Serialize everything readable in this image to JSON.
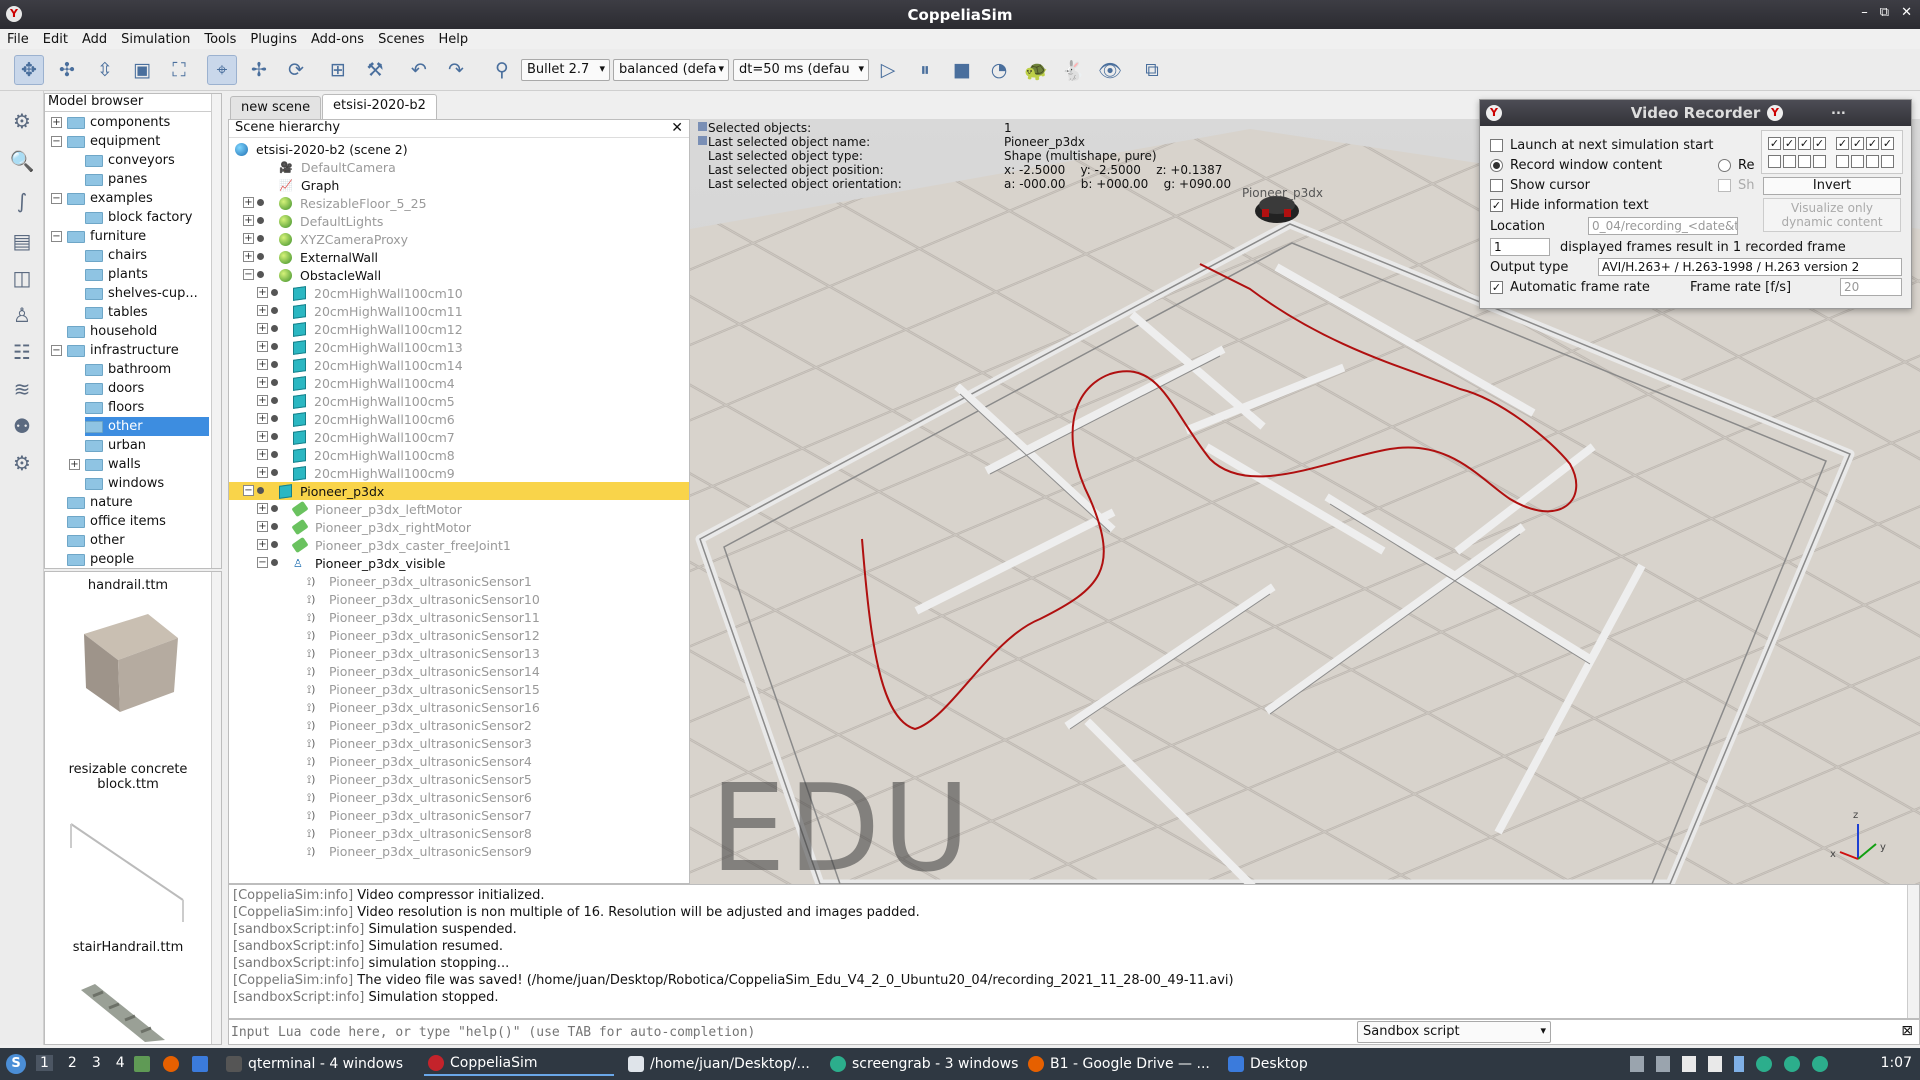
{
  "window": {
    "title": "CoppeliaSim"
  },
  "menu": [
    "File",
    "Edit",
    "Add",
    "Simulation",
    "Tools",
    "Plugins",
    "Add-ons",
    "Scenes",
    "Help"
  ],
  "toolbar": {
    "engine": "Bullet 2.7",
    "accuracy": "balanced (defa",
    "dt": "dt=50 ms (defau"
  },
  "model_browser": {
    "title": "Model browser",
    "items": [
      {
        "label": "components",
        "level": 0,
        "exp": "+"
      },
      {
        "label": "equipment",
        "level": 0,
        "exp": "-"
      },
      {
        "label": "conveyors",
        "level": 1
      },
      {
        "label": "panes",
        "level": 1
      },
      {
        "label": "examples",
        "level": 0,
        "exp": "-"
      },
      {
        "label": "block factory",
        "level": 1
      },
      {
        "label": "furniture",
        "level": 0,
        "exp": "-"
      },
      {
        "label": "chairs",
        "level": 1
      },
      {
        "label": "plants",
        "level": 1
      },
      {
        "label": "shelves-cup...",
        "level": 1
      },
      {
        "label": "tables",
        "level": 1
      },
      {
        "label": "household",
        "level": 0
      },
      {
        "label": "infrastructure",
        "level": 0,
        "exp": "-"
      },
      {
        "label": "bathroom",
        "level": 1
      },
      {
        "label": "doors",
        "level": 1
      },
      {
        "label": "floors",
        "level": 1
      },
      {
        "label": "other",
        "level": 1,
        "selected": true
      },
      {
        "label": "urban",
        "level": 1
      },
      {
        "label": "walls",
        "level": 1,
        "exp": "+"
      },
      {
        "label": "windows",
        "level": 1
      },
      {
        "label": "nature",
        "level": 0
      },
      {
        "label": "office items",
        "level": 0
      },
      {
        "label": "other",
        "level": 0
      },
      {
        "label": "people",
        "level": 0
      }
    ],
    "thumbs": [
      {
        "label": "handrail.ttm"
      },
      {
        "label": "resizable concrete block.ttm"
      },
      {
        "label": "stairHandrail.ttm"
      }
    ]
  },
  "scene_tabs": [
    "new scene",
    "etsisi-2020-b2"
  ],
  "hierarchy": {
    "title": "Scene hierarchy",
    "rows": [
      {
        "label": "etsisi-2020-b2 (scene 2)",
        "indent": 0,
        "icon": "world"
      },
      {
        "label": "DefaultCamera",
        "indent": 1,
        "icon": "camera",
        "dim": true
      },
      {
        "label": "Graph",
        "indent": 1,
        "icon": "graph"
      },
      {
        "label": "ResizableFloor_5_25",
        "indent": 1,
        "icon": "sph",
        "dim": true,
        "exp": "+"
      },
      {
        "label": "DefaultLights",
        "indent": 1,
        "icon": "sph",
        "dim": true,
        "exp": "+"
      },
      {
        "label": "XYZCameraProxy",
        "indent": 1,
        "icon": "sph",
        "dim": true,
        "exp": "+"
      },
      {
        "label": "ExternalWall",
        "indent": 1,
        "icon": "sph",
        "exp": "+"
      },
      {
        "label": "ObstacleWall",
        "indent": 1,
        "icon": "sph",
        "exp": "-"
      },
      {
        "label": "20cmHighWall100cm10",
        "indent": 2,
        "icon": "cube",
        "dim": true,
        "exp": "+"
      },
      {
        "label": "20cmHighWall100cm11",
        "indent": 2,
        "icon": "cube",
        "dim": true,
        "exp": "+"
      },
      {
        "label": "20cmHighWall100cm12",
        "indent": 2,
        "icon": "cube",
        "dim": true,
        "exp": "+"
      },
      {
        "label": "20cmHighWall100cm13",
        "indent": 2,
        "icon": "cube",
        "dim": true,
        "exp": "+"
      },
      {
        "label": "20cmHighWall100cm14",
        "indent": 2,
        "icon": "cube",
        "dim": true,
        "exp": "+"
      },
      {
        "label": "20cmHighWall100cm4",
        "indent": 2,
        "icon": "cube",
        "dim": true,
        "exp": "+"
      },
      {
        "label": "20cmHighWall100cm5",
        "indent": 2,
        "icon": "cube",
        "dim": true,
        "exp": "+"
      },
      {
        "label": "20cmHighWall100cm6",
        "indent": 2,
        "icon": "cube",
        "dim": true,
        "exp": "+"
      },
      {
        "label": "20cmHighWall100cm7",
        "indent": 2,
        "icon": "cube",
        "dim": true,
        "exp": "+"
      },
      {
        "label": "20cmHighWall100cm8",
        "indent": 2,
        "icon": "cube",
        "dim": true,
        "exp": "+"
      },
      {
        "label": "20cmHighWall100cm9",
        "indent": 2,
        "icon": "cube",
        "dim": true,
        "exp": "+"
      },
      {
        "label": "Pioneer_p3dx",
        "indent": 1,
        "icon": "cube",
        "exp": "-",
        "selected": true
      },
      {
        "label": "Pioneer_p3dx_leftMotor",
        "indent": 2,
        "icon": "joint",
        "dim": true,
        "exp": "+"
      },
      {
        "label": "Pioneer_p3dx_rightMotor",
        "indent": 2,
        "icon": "joint",
        "dim": true,
        "exp": "+"
      },
      {
        "label": "Pioneer_p3dx_caster_freeJoint1",
        "indent": 2,
        "icon": "joint",
        "dim": true,
        "exp": "+"
      },
      {
        "label": "Pioneer_p3dx_visible",
        "indent": 2,
        "icon": "dummy",
        "exp": "-"
      },
      {
        "label": "Pioneer_p3dx_ultrasonicSensor1",
        "indent": 3,
        "icon": "sensor",
        "dim": true
      },
      {
        "label": "Pioneer_p3dx_ultrasonicSensor10",
        "indent": 3,
        "icon": "sensor",
        "dim": true
      },
      {
        "label": "Pioneer_p3dx_ultrasonicSensor11",
        "indent": 3,
        "icon": "sensor",
        "dim": true
      },
      {
        "label": "Pioneer_p3dx_ultrasonicSensor12",
        "indent": 3,
        "icon": "sensor",
        "dim": true
      },
      {
        "label": "Pioneer_p3dx_ultrasonicSensor13",
        "indent": 3,
        "icon": "sensor",
        "dim": true
      },
      {
        "label": "Pioneer_p3dx_ultrasonicSensor14",
        "indent": 3,
        "icon": "sensor",
        "dim": true
      },
      {
        "label": "Pioneer_p3dx_ultrasonicSensor15",
        "indent": 3,
        "icon": "sensor",
        "dim": true
      },
      {
        "label": "Pioneer_p3dx_ultrasonicSensor16",
        "indent": 3,
        "icon": "sensor",
        "dim": true
      },
      {
        "label": "Pioneer_p3dx_ultrasonicSensor2",
        "indent": 3,
        "icon": "sensor",
        "dim": true
      },
      {
        "label": "Pioneer_p3dx_ultrasonicSensor3",
        "indent": 3,
        "icon": "sensor",
        "dim": true
      },
      {
        "label": "Pioneer_p3dx_ultrasonicSensor4",
        "indent": 3,
        "icon": "sensor",
        "dim": true
      },
      {
        "label": "Pioneer_p3dx_ultrasonicSensor5",
        "indent": 3,
        "icon": "sensor",
        "dim": true
      },
      {
        "label": "Pioneer_p3dx_ultrasonicSensor6",
        "indent": 3,
        "icon": "sensor",
        "dim": true
      },
      {
        "label": "Pioneer_p3dx_ultrasonicSensor7",
        "indent": 3,
        "icon": "sensor",
        "dim": true
      },
      {
        "label": "Pioneer_p3dx_ultrasonicSensor8",
        "indent": 3,
        "icon": "sensor",
        "dim": true
      },
      {
        "label": "Pioneer_p3dx_ultrasonicSensor9",
        "indent": 3,
        "icon": "sensor",
        "dim": true
      }
    ]
  },
  "info": {
    "selected_objects_label": "Selected objects:",
    "selected_objects": "1",
    "name_label": "Last selected object name:",
    "name": "Pioneer_p3dx",
    "type_label": "Last selected object type:",
    "type": "Shape (multishape, pure)",
    "position_label": "Last selected object position:",
    "position": "x: -2.5000    y: -2.5000    z: +0.1387",
    "orientation_label": "Last selected object orientation:",
    "orientation": "a: -000.00    b: +000.00    g: +090.00"
  },
  "viewport": {
    "watermark": "EDU",
    "robot_label": "Pioneer_p3dx",
    "axes": {
      "x": "x",
      "y": "y",
      "z": "z"
    },
    "trail_color": "#b01010"
  },
  "video_recorder": {
    "title": "Video Recorder",
    "menu_dots": "...",
    "launch": "Launch at next simulation start",
    "record_window": "Record window content",
    "record_partial": "Re",
    "show_cursor": "Show cursor",
    "show_partial": "Sh",
    "hide_info": "Hide information text",
    "location_label": "Location",
    "location_value": "0_04/recording_<date&t",
    "frames_value": "1",
    "frames_text": "displayed frames result in 1 recorded frame",
    "output_label": "Output type",
    "output_value": "AVI/H.263+ / H.263-1998 / H.263 version 2",
    "auto_rate": "Automatic frame rate",
    "rate_label": "Frame rate [f/s]",
    "rate_value": "20",
    "invert": "Invert",
    "visualize": "Visualize only dynamic content"
  },
  "console": [
    {
      "prefix": "[CoppeliaSim:info]",
      "text": " Video compressor initialized."
    },
    {
      "prefix": "[CoppeliaSim:info]",
      "text": " Video resolution is non multiple of 16. Resolution will be adjusted and images padded."
    },
    {
      "prefix": "[sandboxScript:info]",
      "text": " Simulation suspended."
    },
    {
      "prefix": "[sandboxScript:info]",
      "text": " Simulation resumed."
    },
    {
      "prefix": "[sandboxScript:info]",
      "text": " simulation stopping..."
    },
    {
      "prefix": "[CoppeliaSim:info]",
      "text": " The video file was saved! (/home/juan/Desktop/Robotica/CoppeliaSim_Edu_V4_2_0_Ubuntu20_04/recording_2021_11_28-00_49-11.avi)"
    },
    {
      "prefix": "[sandboxScript:info]",
      "text": " Simulation stopped."
    }
  ],
  "lua": {
    "placeholder": "Input Lua code here, or type \"help()\" (use TAB for auto-completion)",
    "script": "Sandbox script"
  },
  "taskbar": {
    "workspaces": [
      "1",
      "2",
      "3",
      "4"
    ],
    "tasks": [
      {
        "label": "qterminal - 4 windows"
      },
      {
        "label": "CoppeliaSim",
        "active": true
      },
      {
        "label": "/home/juan/Desktop/..."
      },
      {
        "label": "screengrab - 3 windows"
      },
      {
        "label": "B1 - Google Drive — ..."
      },
      {
        "label": "Desktop"
      }
    ],
    "clock": "1:07"
  }
}
